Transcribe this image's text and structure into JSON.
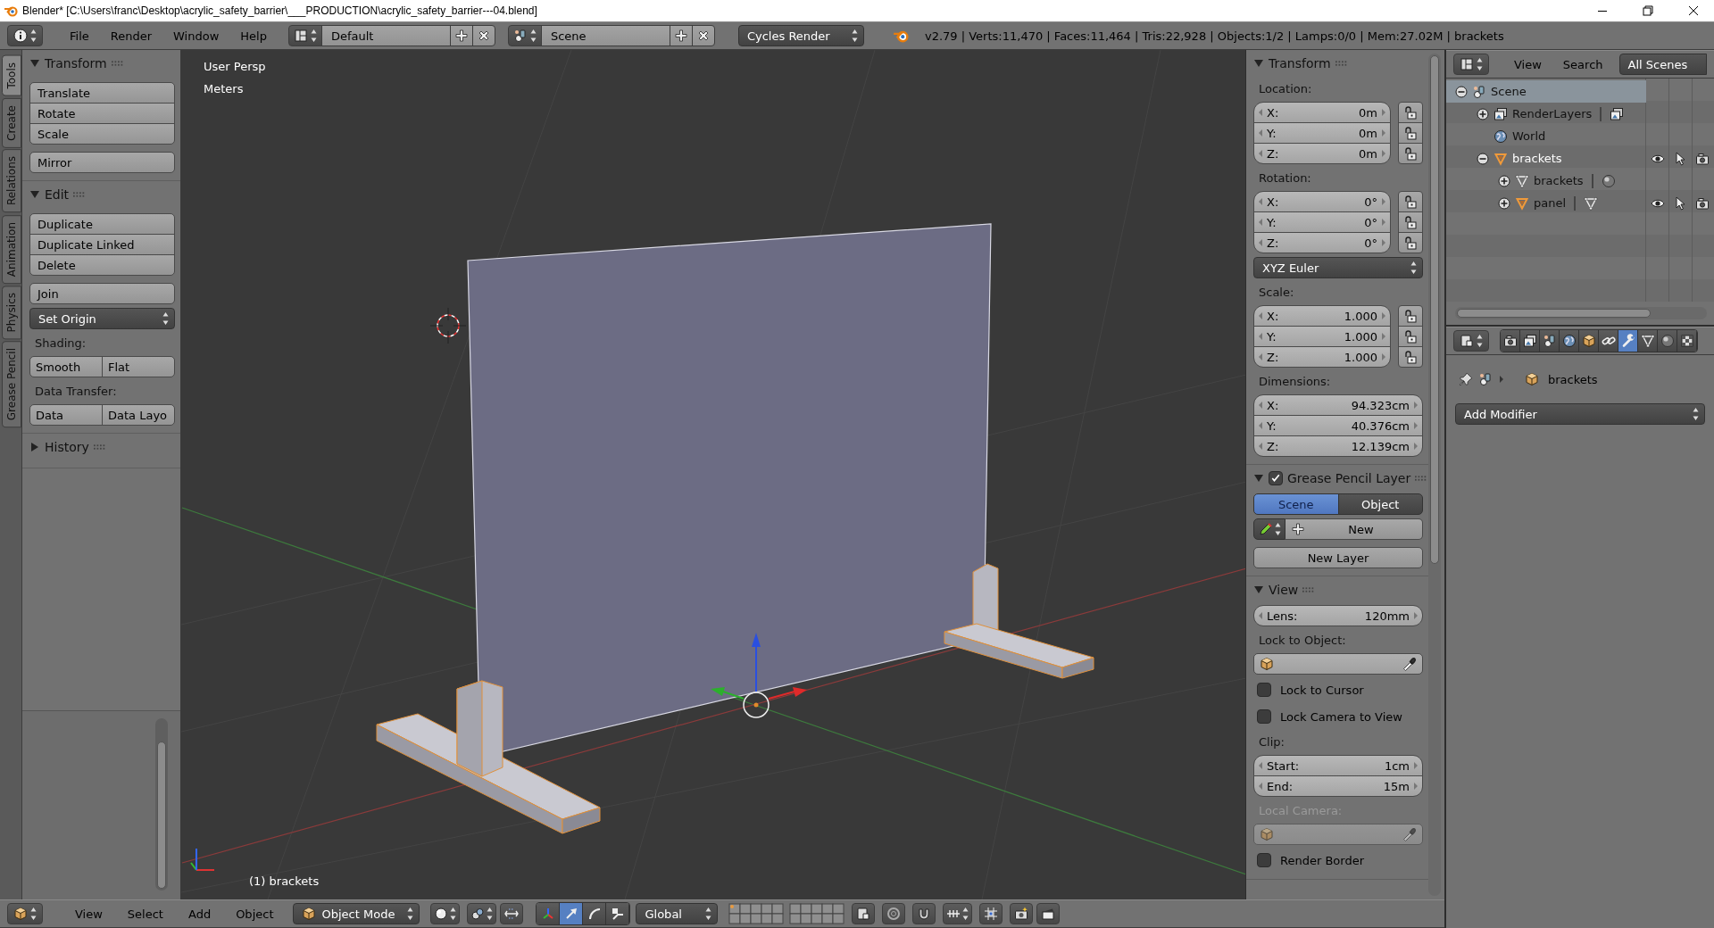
{
  "window": {
    "title": "Blender* [C:\\Users\\franc\\Desktop\\acrylic_safety_barrier\\___PRODUCTION\\acrylic_safety_barrier---04.blend]"
  },
  "info_header": {
    "menus": [
      "File",
      "Render",
      "Window",
      "Help"
    ],
    "screen_layout": "Default",
    "scene": "Scene",
    "render_engine": "Cycles Render",
    "stats": "v2.79 | Verts:11,470 | Faces:11,464 | Tris:22,928 | Objects:1/2 | Lamps:0/0 | Mem:27.02M | brackets"
  },
  "tool_tabs": [
    {
      "label": "Tools",
      "selected": true
    },
    {
      "label": "Create",
      "selected": false
    },
    {
      "label": "Relations",
      "selected": false
    },
    {
      "label": "Animation",
      "selected": false
    },
    {
      "label": "Physics",
      "selected": false
    },
    {
      "label": "Grease Pencil",
      "selected": false
    }
  ],
  "tool_shelf": {
    "panels": [
      {
        "title": "Transform",
        "expanded": true,
        "items": [
          {
            "kind": "column",
            "buttons": [
              "Translate",
              "Rotate",
              "Scale"
            ]
          },
          {
            "kind": "column",
            "buttons": [
              "Mirror"
            ]
          }
        ]
      },
      {
        "title": "Edit",
        "expanded": true,
        "items": [
          {
            "kind": "column",
            "buttons": [
              "Duplicate",
              "Duplicate Linked",
              "Delete"
            ]
          },
          {
            "kind": "column",
            "buttons": [
              "Join"
            ]
          },
          {
            "kind": "dropdown",
            "label": "Set Origin"
          },
          {
            "kind": "label",
            "text": "Shading:",
            "disabled": false
          },
          {
            "kind": "row",
            "buttons": [
              "Smooth",
              "Flat"
            ]
          },
          {
            "kind": "label",
            "text": "Data Transfer:",
            "disabled": false
          },
          {
            "kind": "row",
            "buttons": [
              "Data",
              "Data Layo"
            ]
          }
        ]
      },
      {
        "title": "History",
        "expanded": false
      }
    ]
  },
  "viewport": {
    "view_name": "User Persp",
    "units": "Meters",
    "object_label": "(1) brackets"
  },
  "properties_panel": {
    "panels": [
      {
        "title": "Transform",
        "expanded": true,
        "items": [
          {
            "kind": "label",
            "text": "Location:",
            "disabled": false
          },
          {
            "kind": "vector",
            "fields": [
              {
                "label": "X:",
                "value": "0m",
                "locked": false
              },
              {
                "label": "Y:",
                "value": "0m",
                "locked": false
              },
              {
                "label": "Z:",
                "value": "0m",
                "locked": false
              }
            ]
          },
          {
            "kind": "label",
            "text": "Rotation:",
            "disabled": false
          },
          {
            "kind": "vector",
            "fields": [
              {
                "label": "X:",
                "value": "0°",
                "locked": false
              },
              {
                "label": "Y:",
                "value": "0°",
                "locked": false
              },
              {
                "label": "Z:",
                "value": "0°",
                "locked": false
              }
            ]
          },
          {
            "kind": "dropdown",
            "label": "XYZ Euler"
          },
          {
            "kind": "label",
            "text": "Scale:",
            "disabled": false
          },
          {
            "kind": "vector",
            "fields": [
              {
                "label": "X:",
                "value": "1.000",
                "locked": false
              },
              {
                "label": "Y:",
                "value": "1.000",
                "locked": false
              },
              {
                "label": "Z:",
                "value": "1.000",
                "locked": false
              }
            ]
          },
          {
            "kind": "label",
            "text": "Dimensions:",
            "disabled": false
          },
          {
            "kind": "vector",
            "fields": [
              {
                "label": "X:",
                "value": "94.323cm"
              },
              {
                "label": "Y:",
                "value": "40.376cm"
              },
              {
                "label": "Z:",
                "value": "12.139cm"
              }
            ]
          }
        ]
      },
      {
        "title": "Grease Pencil Layer",
        "expanded": true,
        "checked": true,
        "items": [
          {
            "kind": "toggle_row",
            "options": [
              {
                "label": "Scene",
                "selected": true
              },
              {
                "label": "Object",
                "selected": false
              }
            ]
          },
          {
            "kind": "datablock",
            "label": "New"
          },
          {
            "kind": "column",
            "buttons": [
              "New Layer"
            ]
          }
        ]
      },
      {
        "title": "View",
        "expanded": true,
        "items": [
          {
            "kind": "vector",
            "fields": [
              {
                "label": "Lens:",
                "value": "120mm"
              }
            ]
          },
          {
            "kind": "label",
            "text": "Lock to Object:",
            "disabled": false
          },
          {
            "kind": "object_field",
            "disabled": false
          },
          {
            "kind": "checkbox",
            "label": "Lock to Cursor",
            "checked": false
          },
          {
            "kind": "checkbox",
            "label": "Lock Camera to View",
            "checked": false
          },
          {
            "kind": "label",
            "text": "Clip:",
            "disabled": false
          },
          {
            "kind": "vector",
            "fields": [
              {
                "label": "Start:",
                "value": "1cm"
              },
              {
                "label": "End:",
                "value": "15m"
              }
            ]
          },
          {
            "kind": "label",
            "text": "Local Camera:",
            "disabled": true
          },
          {
            "kind": "object_field",
            "disabled": true
          },
          {
            "kind": "checkbox",
            "label": "Render Border",
            "checked": false
          }
        ]
      }
    ]
  },
  "outliner": {
    "menus": [
      "View",
      "Search"
    ],
    "display_mode": "All Scenes",
    "tree": [
      {
        "label": "Scene",
        "kind": "scene",
        "expanded": true,
        "selected": true,
        "active": false,
        "children": [
          {
            "label": "RenderLayers",
            "kind": "render_layers",
            "expanded": false,
            "selected": false,
            "active": false,
            "extra": {
              "kind": "render_layers"
            }
          },
          {
            "label": "World",
            "kind": "world",
            "selected": false,
            "active": false
          },
          {
            "label": "brackets",
            "kind": "object",
            "expanded": true,
            "selected": false,
            "active": true,
            "children": [
              {
                "label": "brackets",
                "kind": "mesh",
                "expanded": false,
                "selected": false,
                "active": false,
                "extra": {
                  "kind": "material"
                }
              },
              {
                "label": "panel",
                "kind": "object",
                "expanded": false,
                "selected": false,
                "active": false,
                "extra": {
                  "kind": "mesh"
                }
              }
            ]
          }
        ]
      }
    ]
  },
  "properties_editor": {
    "tabs": [
      {
        "kind": "render",
        "selected": false
      },
      {
        "kind": "render_layers",
        "selected": false
      },
      {
        "kind": "scene",
        "selected": false
      },
      {
        "kind": "world",
        "selected": false
      },
      {
        "kind": "object",
        "selected": false
      },
      {
        "kind": "constraints",
        "selected": false
      },
      {
        "kind": "modifiers",
        "selected": true
      },
      {
        "kind": "data",
        "selected": false
      },
      {
        "kind": "material",
        "selected": false
      },
      {
        "kind": "texture",
        "selected": false
      }
    ],
    "context": "brackets",
    "add_modifier": "Add Modifier"
  },
  "view3d_header": {
    "menus": [
      "View",
      "Select",
      "Add",
      "Object"
    ],
    "mode": "Object Mode",
    "manipulators": [
      {
        "kind": "axes",
        "selected": false
      },
      {
        "kind": "translate",
        "selected": true
      },
      {
        "kind": "rotate",
        "selected": false
      },
      {
        "kind": "scale",
        "selected": false
      }
    ],
    "orientation": "Global"
  }
}
